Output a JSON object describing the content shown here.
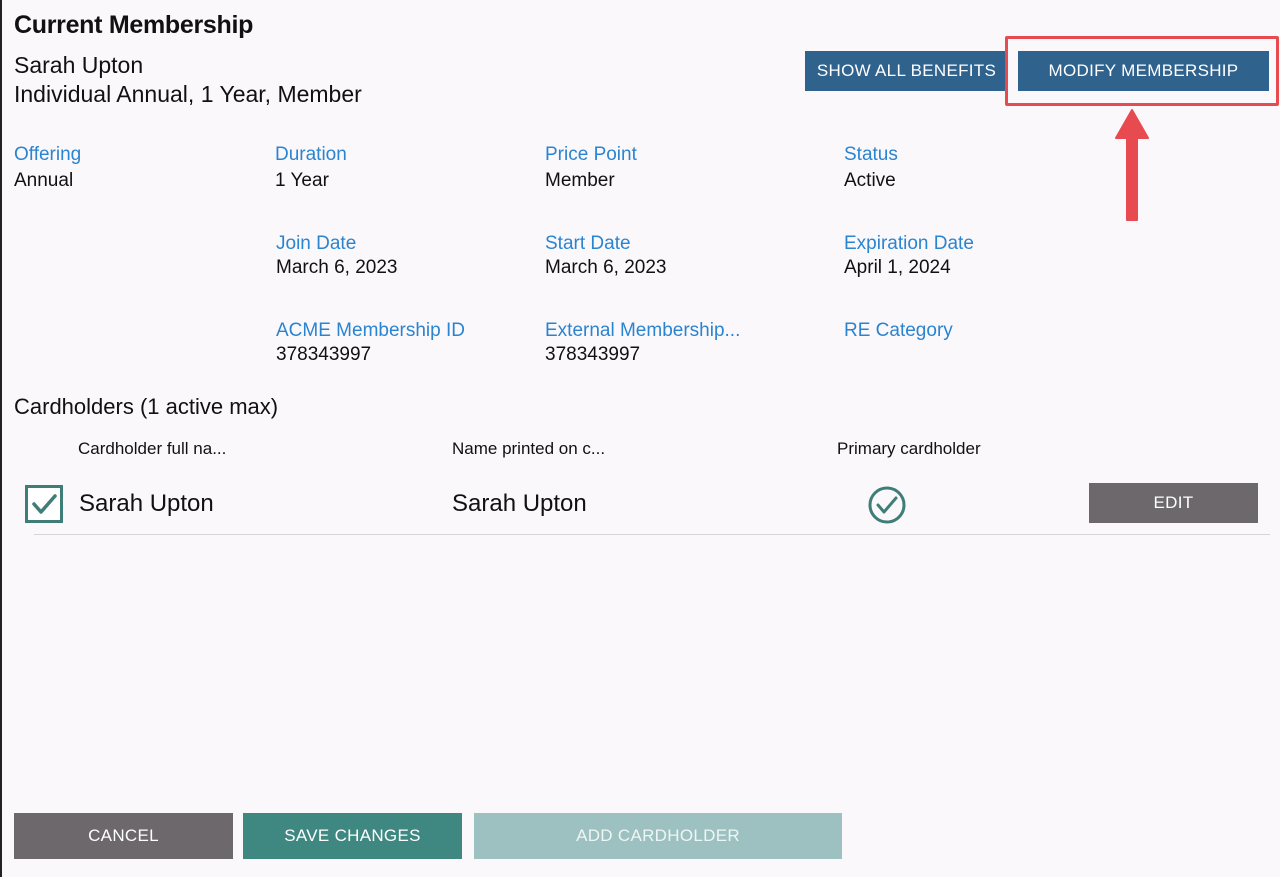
{
  "header": {
    "title": "Current Membership",
    "member_name": "Sarah Upton",
    "member_summary": "Individual Annual, 1 Year, Member"
  },
  "actions": {
    "show_all_benefits": "SHOW ALL BENEFITS",
    "modify_membership": "MODIFY MEMBERSHIP"
  },
  "details": {
    "offering": {
      "label": "Offering",
      "value": "Annual"
    },
    "duration": {
      "label": "Duration",
      "value": "1 Year"
    },
    "price_point": {
      "label": "Price Point",
      "value": "Member"
    },
    "status": {
      "label": "Status",
      "value": "Active"
    },
    "join_date": {
      "label": "Join Date",
      "value": "March 6, 2023"
    },
    "start_date": {
      "label": "Start Date",
      "value": "March 6, 2023"
    },
    "expiration_date": {
      "label": "Expiration Date",
      "value": "April 1, 2024"
    },
    "acme_membership_id": {
      "label": "ACME Membership ID",
      "value": "378343997"
    },
    "external_membership": {
      "label": "External Membership...",
      "value": "378343997"
    },
    "re_category": {
      "label": "RE Category",
      "value": ""
    }
  },
  "cardholders": {
    "title": "Cardholders (1 active max)",
    "columns": [
      "Cardholder full na...",
      "Name printed on c...",
      "Primary cardholder"
    ],
    "rows": [
      {
        "full_name": "Sarah Upton",
        "printed_name": "Sarah Upton",
        "active": true,
        "primary": true,
        "edit_label": "EDIT"
      }
    ]
  },
  "footer": {
    "cancel": "CANCEL",
    "save_changes": "SAVE CHANGES",
    "add_cardholder": "ADD CARDHOLDER"
  },
  "colors": {
    "primary_blue": "#2f628c",
    "teal": "#3f8781",
    "label_blue": "#2b84d0",
    "highlight_red": "#e74a4f"
  }
}
